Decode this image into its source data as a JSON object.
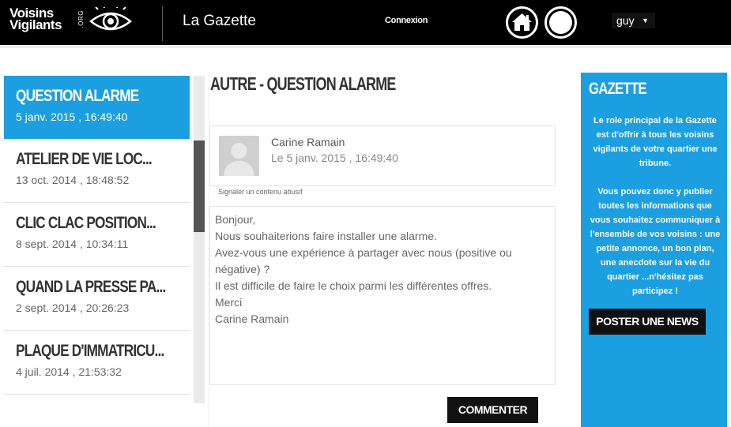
{
  "header": {
    "logo_line1": "Voisins",
    "logo_line2": "Vigilants",
    "logo_org": ".ORG",
    "app_title": "La Gazette",
    "login_link": "Connexion",
    "username": "guy",
    "user_caret": "▼"
  },
  "sidebar": {
    "items": [
      {
        "title": "QUESTION ALARME",
        "date": "5 janv. 2015 , 16:49:40"
      },
      {
        "title": "ATELIER DE VIE LOC...",
        "date": "13 oct. 2014 , 18:48:52"
      },
      {
        "title": "CLIC CLAC POSITION...",
        "date": "8 sept. 2014 , 10:34:11"
      },
      {
        "title": "QUAND LA PRESSE PA...",
        "date": "2 sept. 2014 , 20:26:23"
      },
      {
        "title": "PLAQUE D'IMMATRICU...",
        "date": "4 juil. 2014 , 21:53:32"
      }
    ]
  },
  "main": {
    "title": "AUTRE - QUESTION ALARME",
    "author": "Carine Ramain",
    "date": "Le 5 janv. 2015 , 16:49:40",
    "report_link": "Signaler un contenu abusif",
    "message_lines": [
      "Bonjour,",
      "Nous souhaiterions faire installer une alarme.",
      "Avez-vous une expérience à partager avec nous (positive ou",
      "négative) ?",
      "Il est difficile de faire le choix parmi les différentes offres.",
      "Merci",
      "Carine Ramain"
    ],
    "comment_button": "COMMENTER"
  },
  "right_panel": {
    "title": "GAZETTE",
    "paragraph1": "Le role principal de la Gazette est d'offrir à tous les voisins vigilants de votre quartier une tribune.",
    "paragraph2": "Vous pouvez donc y publier toutes les informations que vous souhaitez communiquer à l'ensemble de vos voisins : une petite annonce, un bon plan, une anecdote sur la vie du quartier ...n'hésitez pas participez !",
    "post_button": "POSTER UNE NEWS"
  },
  "colors": {
    "accent": "#1c9fe0",
    "header_bg": "#000000",
    "button_bg": "#111111"
  }
}
